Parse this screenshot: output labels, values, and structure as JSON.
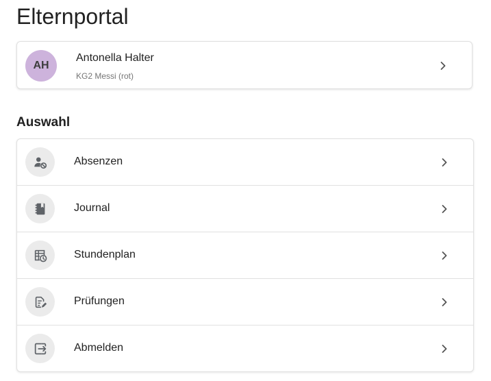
{
  "page": {
    "title": "Elternportal"
  },
  "profile": {
    "initials": "AH",
    "name": "Antonella Halter",
    "class": "KG2 Messi (rot)",
    "avatar_color": "#cdb3dc"
  },
  "section": {
    "title": "Auswahl"
  },
  "menu": {
    "items": [
      {
        "label": "Absenzen",
        "icon": "person-absence-icon"
      },
      {
        "label": "Journal",
        "icon": "journal-icon"
      },
      {
        "label": "Stundenplan",
        "icon": "timetable-icon"
      },
      {
        "label": "Prüfungen",
        "icon": "exam-edit-icon"
      },
      {
        "label": "Abmelden",
        "icon": "logout-icon"
      }
    ]
  },
  "colors": {
    "icon_bg": "#ebebeb",
    "icon_fg": "#5f6368",
    "text": "#212121",
    "secondary_text": "#757575",
    "border": "#e0e0e0"
  }
}
